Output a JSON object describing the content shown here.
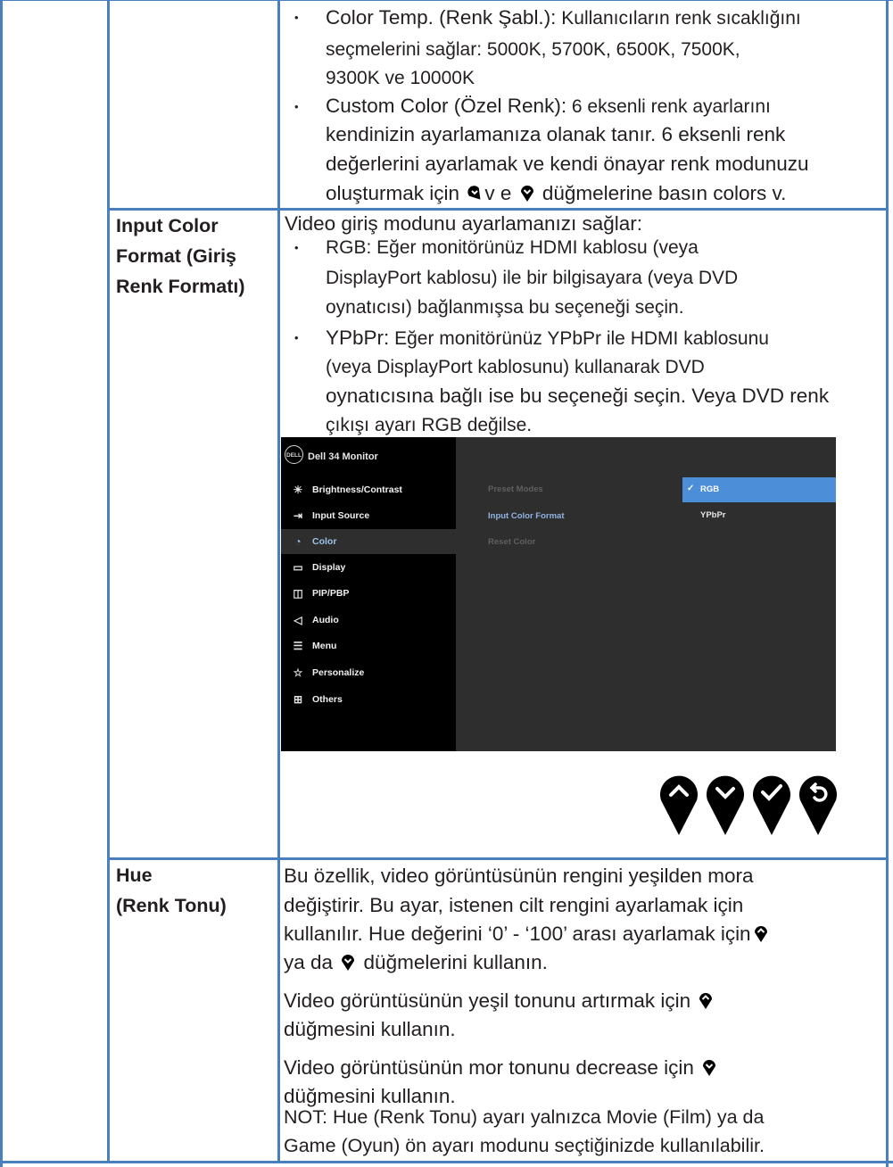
{
  "colors": {
    "border": "#4a7fbf",
    "text": "#231f20",
    "osd_left": "#000000",
    "osd_right": "#2e2e2e",
    "osd_select": "#4d8ed9",
    "osd_active_text": "#9fc2ea"
  },
  "row1": {
    "b1_term": "Color Temp. (Renk Şabl.):",
    "b1_l1": " Kullanıcıların renk sıcaklığını",
    "b1_l2": "seçmelerini sağlar: 5000K, 5700K, 6500K, 7500K,",
    "b1_l3": "9300K ve 10000K",
    "b2_term": "Custom Color (Özel Renk):",
    "b2_l1": " 6 eksenli renk ayarlarını",
    "b2_l2": "kendinizin ayarlamanıza olanak tanır.  6 eksenli renk",
    "b2_l3": "değerlerini ayarlamak ve kendi önayar renk modunuzu",
    "b2_l4a": "oluşturmak için ",
    "b2_l4b": "v e ",
    "b2_l4c": " düğmelerine basın colors v."
  },
  "row2": {
    "label_l1": "Input Color",
    "label_l2": "Format (Giriş",
    "label_l3": "Renk Formatı)",
    "intro": "Video giriş modunu ayarlamanızı sağlar:",
    "rgb_term": "RGB:",
    "rgb_l1": " Eğer monitörünüz HDMI kablosu (veya",
    "rgb_l2": "DisplayPort kablosu) ile bir bilgisayara (veya DVD",
    "rgb_l3": "oynatıcısı) bağlanmışsa bu seçeneği seçin.",
    "ypbpr_term": "YPbPr:",
    "ypbpr_l1": " Eğer monitörünüz YPbPr ile HDMI kablosunu",
    "ypbpr_l2": "(veya DisplayPort kablosunu) kullanarak DVD",
    "ypbpr_l3": "oynatıcısına bağlı ise bu seçeneği seçin. Veya DVD renk",
    "ypbpr_l4": "çıkışı ayarı RGB değilse."
  },
  "osd": {
    "logo": "DELL",
    "title": "Dell 34 Monitor",
    "menu": [
      {
        "icon": "brightness-icon",
        "glyph": "☀",
        "label": "Brightness/Contrast"
      },
      {
        "icon": "input-source-icon",
        "glyph": "⇥",
        "label": "Input Source"
      },
      {
        "icon": "color-palette-icon",
        "glyph": "◔",
        "label": "Color"
      },
      {
        "icon": "display-icon",
        "glyph": "▭",
        "label": "Display"
      },
      {
        "icon": "pip-pbp-icon",
        "glyph": "◫",
        "label": "PIP/PBP"
      },
      {
        "icon": "audio-icon",
        "glyph": "◁",
        "label": "Audio"
      },
      {
        "icon": "menu-icon",
        "glyph": "☰",
        "label": "Menu"
      },
      {
        "icon": "personalize-star-icon",
        "glyph": "☆",
        "label": "Personalize"
      },
      {
        "icon": "others-icon",
        "glyph": "⊞",
        "label": "Others"
      }
    ],
    "sub": [
      "Preset Modes",
      "Input Color Format",
      "Reset Color"
    ],
    "options": [
      "RGB",
      "YPbPr"
    ],
    "check": "✓"
  },
  "row3": {
    "label_l1": "Hue",
    "label_l2": "(Renk Tonu)",
    "p1_l1": "Bu özellik, video görüntüsünün rengini yeşilden mora",
    "p1_l2": "değiştirir. Bu ayar, istenen cilt rengini ayarlamak için",
    "p1_l3": "kullanılır. Hue değerini ‘0’ - ‘100’ arası ayarlamak için",
    "p1_l4a": "ya da ",
    "p1_l4b": " düğmelerini kullanın.",
    "p2_l1": "Video görüntüsünün yeşil tonunu artırmak için ",
    "p2_l2": "düğmesini kullanın.",
    "p3_l1": "Video görüntüsünün mor tonunu decrease için ",
    "p3_l2": "düğmesini kullanın.",
    "p4_l1": "NOT: Hue (Renk Tonu) ayarı yalnızca Movie (Film) ya da",
    "p4_l2": "Game (Oyun) ön ayarı modunu seçtiğinizde kullanılabilir."
  }
}
